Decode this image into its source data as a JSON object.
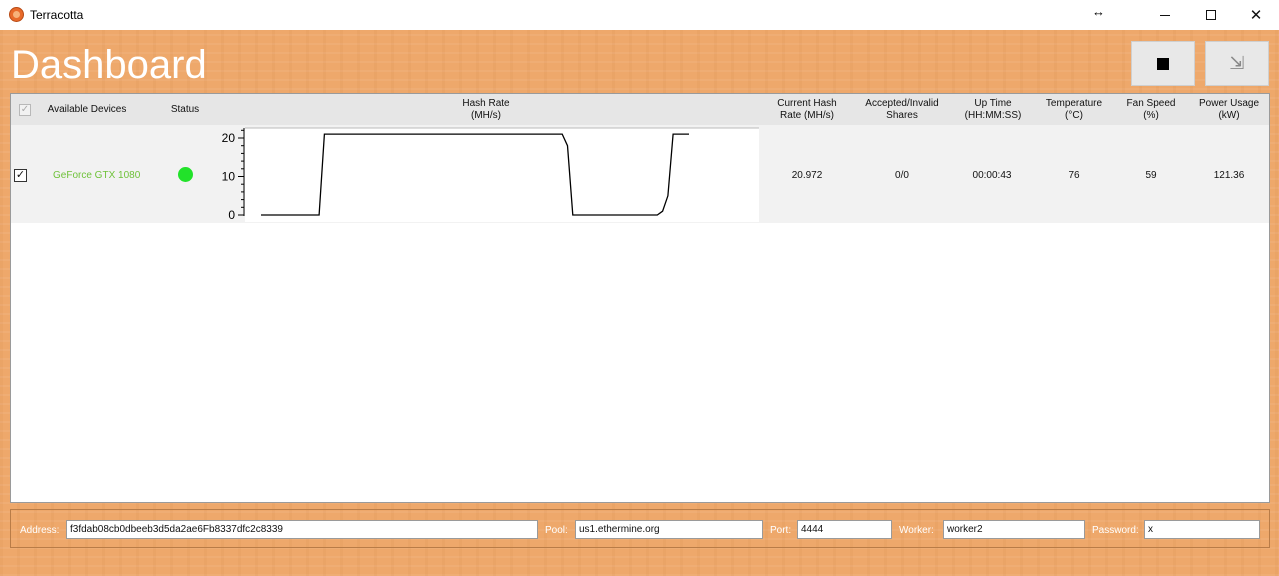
{
  "window": {
    "title": "Terracotta"
  },
  "page": {
    "title": "Dashboard"
  },
  "table": {
    "headers": {
      "available_devices": "Available Devices",
      "status": "Status",
      "hash_rate_line1": "Hash Rate",
      "hash_rate_line2": "(MH/s)",
      "current_hash_line1": "Current Hash",
      "current_hash_line2": "Rate (MH/s)",
      "shares_line1": "Accepted/Invalid",
      "shares_line2": "Shares",
      "uptime_line1": "Up Time",
      "uptime_line2": "(HH:MM:SS)",
      "temperature_line1": "Temperature",
      "temperature_line2": "(°C)",
      "fan_line1": "Fan Speed",
      "fan_line2": "(%)",
      "power_line1": "Power Usage",
      "power_line2": "(kW)"
    },
    "rows": [
      {
        "checked": true,
        "device": "GeForce GTX 1080",
        "status_color": "#22e22a",
        "current_hash_rate": "20.972",
        "shares": "0/0",
        "uptime": "00:00:43",
        "temperature": "76",
        "fan_speed": "59",
        "power_usage": "121.36"
      }
    ]
  },
  "chart_data": {
    "type": "line",
    "title": "",
    "xlabel": "",
    "ylabel": "",
    "ylim": [
      0,
      22
    ],
    "yticks": [
      0,
      10,
      20
    ],
    "ytick_labels": [
      "0",
      "10",
      "20"
    ],
    "grid": false,
    "series": [
      {
        "values": [
          0,
          0,
          0,
          0,
          0,
          0,
          0,
          0,
          0,
          0,
          0,
          0,
          21,
          21,
          21,
          21,
          21,
          21,
          21,
          21,
          21,
          21,
          21,
          21,
          21,
          21,
          21,
          21,
          21,
          21,
          21,
          21,
          21,
          21,
          21,
          21,
          21,
          21,
          21,
          21,
          21,
          21,
          21,
          21,
          21,
          21,
          21,
          21,
          21,
          21,
          21,
          21,
          21,
          21,
          21,
          21,
          21,
          21,
          18,
          0,
          0,
          0,
          0,
          0,
          0,
          0,
          0,
          0,
          0,
          0,
          0,
          0,
          0,
          0,
          0,
          0,
          1,
          5,
          21,
          21,
          21,
          21
        ]
      }
    ]
  },
  "connection": {
    "address_label": "Address:",
    "address_value": "f3fdab08cb0dbeeb3d5da2ae6Fb8337dfc2c8339",
    "pool_label": "Pool:",
    "pool_value": "us1.ethermine.org",
    "port_label": "Port:",
    "port_value": "4444",
    "worker_label": "Worker:",
    "worker_value": "worker2",
    "password_label": "Password:",
    "password_value": "x"
  },
  "colors": {
    "background": "#eea86b",
    "device_name": "#6fc23a",
    "status_ok": "#22e22a"
  }
}
